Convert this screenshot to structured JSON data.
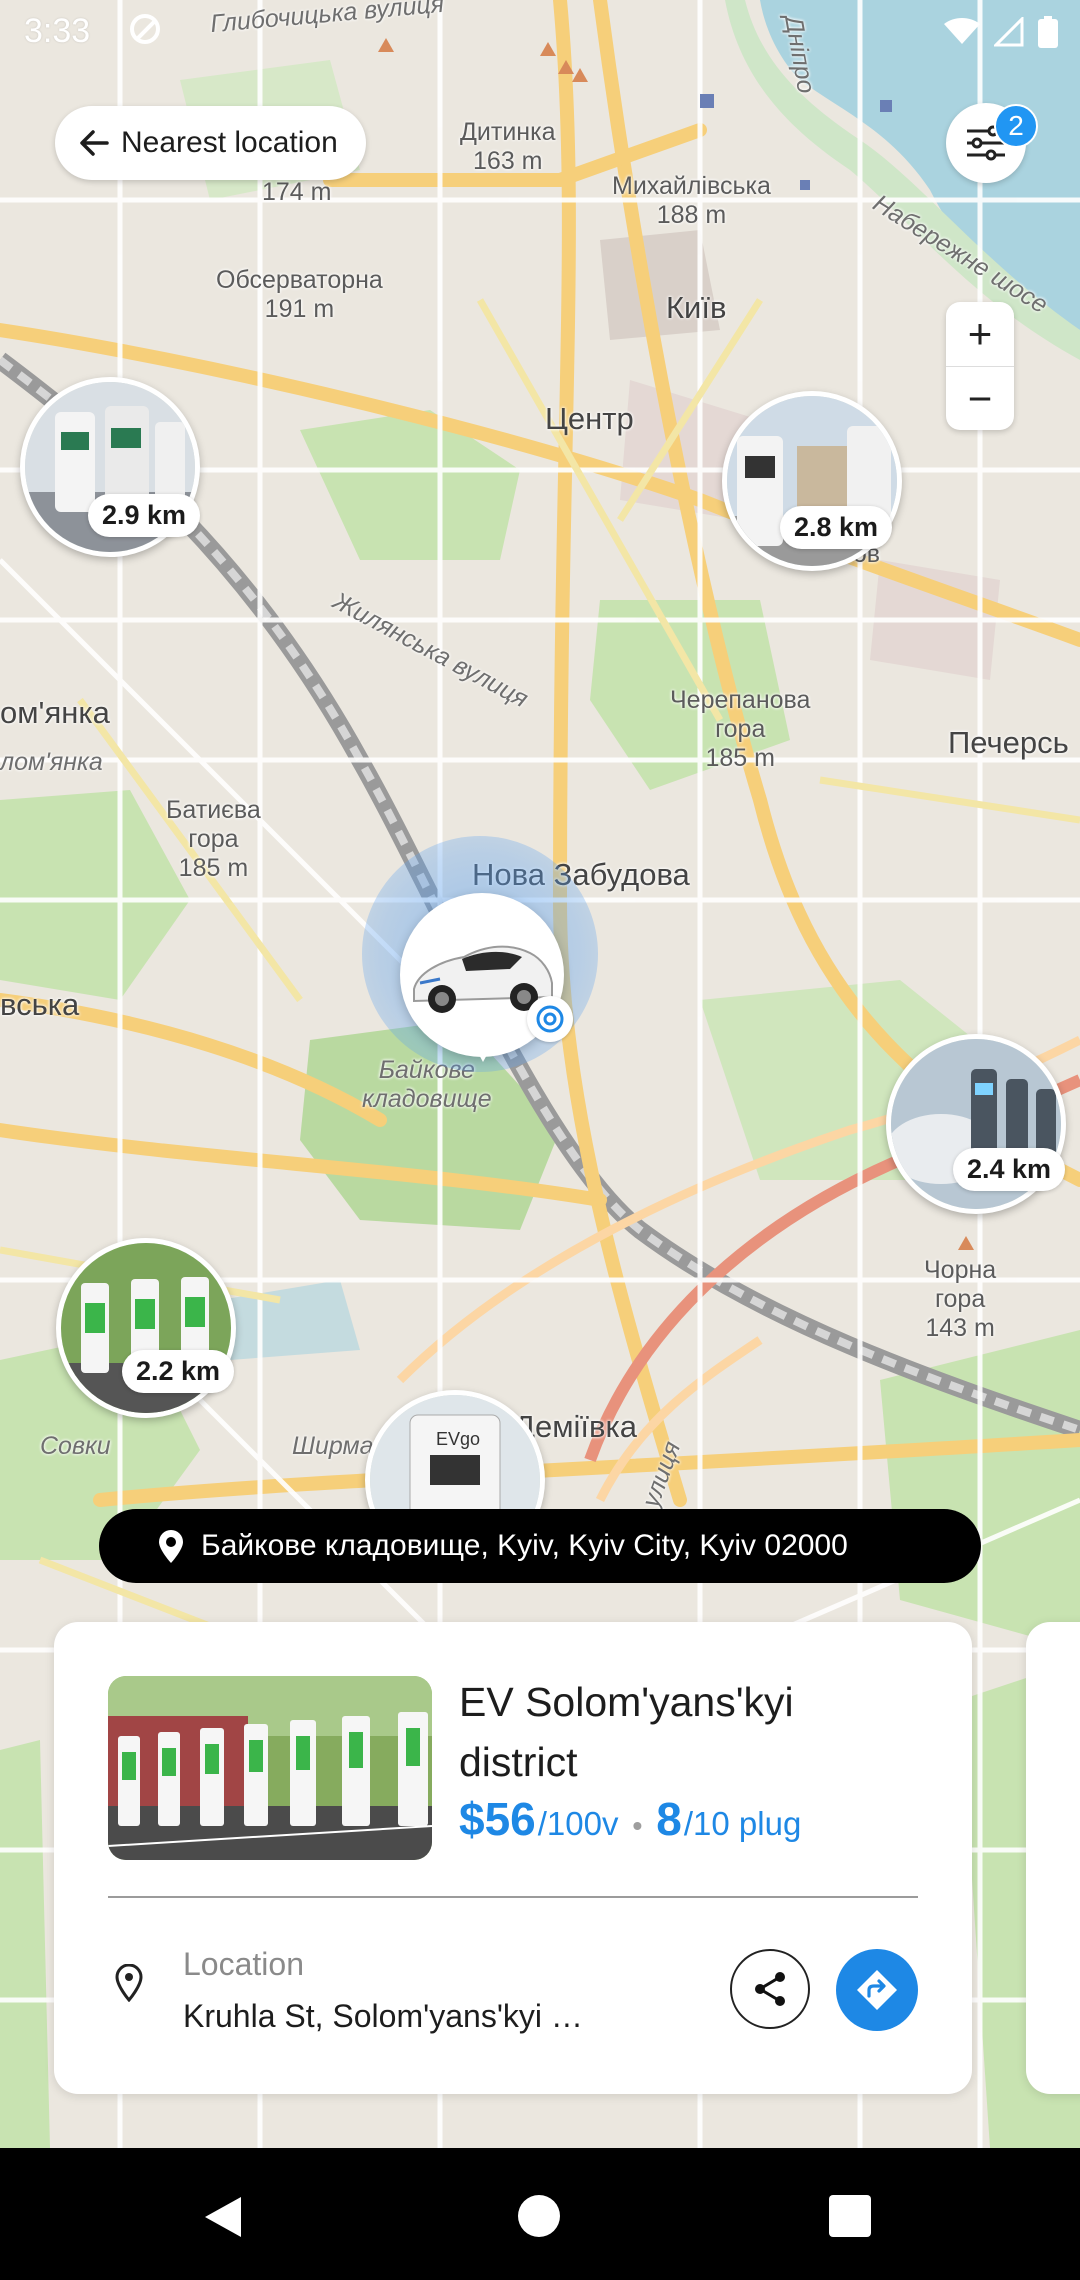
{
  "status_bar": {
    "time": "3:33"
  },
  "top": {
    "back_label": "Nearest location",
    "filter_badge": "2"
  },
  "map": {
    "labels": [
      {
        "text": "Глибочицька вулиця",
        "style": "italic"
      },
      {
        "text": "Дитинка\n163 m",
        "style": "normal"
      },
      {
        "text": "Михайлівська\n188 m",
        "style": "normal"
      },
      {
        "text": "174 m",
        "style": "normal"
      },
      {
        "text": "Обсерваторна\n191 m",
        "style": "normal"
      },
      {
        "text": "Київ",
        "style": "big"
      },
      {
        "text": "Центр",
        "style": "big"
      },
      {
        "text": "Дніпро",
        "style": "italic"
      },
      {
        "text": "Набережне шосе",
        "style": "italic"
      },
      {
        "text": "Жилянська вулиця",
        "style": "italic"
      },
      {
        "text": "ом'янка",
        "style": "big"
      },
      {
        "text": "лом'янка",
        "style": "italic"
      },
      {
        "text": "Черепанова\nгора\n185 m",
        "style": "normal"
      },
      {
        "text": "Печерсь",
        "style": "big"
      },
      {
        "text": "Батиєва\nгора\n185 m",
        "style": "normal"
      },
      {
        "text": "Нова Забудова",
        "style": "big"
      },
      {
        "text": "вська",
        "style": "big"
      },
      {
        "text": "Байкове\nкладовище",
        "style": "italic"
      },
      {
        "text": "Чорна\nгора\n143 m",
        "style": "normal"
      },
      {
        "text": "Деміївка",
        "style": "big"
      },
      {
        "text": "Совки",
        "style": "italic"
      },
      {
        "text": "Ширма",
        "style": "italic"
      },
      {
        "text": "улиця",
        "style": "italic"
      },
      {
        "text": "лов",
        "style": "normal"
      },
      {
        "text": "ва",
        "style": "normal"
      }
    ]
  },
  "markers": [
    {
      "distance": "2.9 km",
      "icon": "charging-station-photo"
    },
    {
      "distance": "2.8 km",
      "icon": "charging-station-photo"
    },
    {
      "distance": "2.4 km",
      "icon": "charging-station-photo"
    },
    {
      "distance": "2.2 km",
      "icon": "charging-station-photo"
    },
    {
      "distance": "",
      "icon": "charging-station-photo",
      "brand": "EVgo"
    }
  ],
  "address_pill": {
    "text": "Байкове кладовище, Kyiv, Kyiv City, Kyiv 02000"
  },
  "station": {
    "name": "EV Solom'yans'kyi district",
    "price": "$56",
    "price_unit": "/100v",
    "plugs_available": "8",
    "plugs_total": "/10 plug",
    "location_label": "Location",
    "location_value": "Kruhla St, Solom'yans'kyi district"
  },
  "colors": {
    "accent": "#1e88e5",
    "badge": "#2196f3",
    "pill": "#000000"
  }
}
